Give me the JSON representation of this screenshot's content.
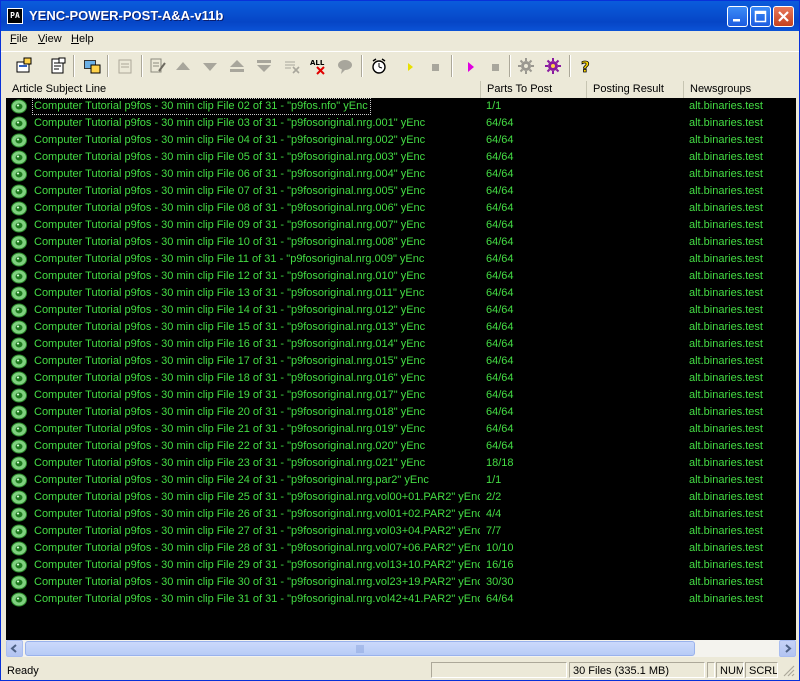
{
  "window": {
    "title": "YENC-POWER-POST-A&A-v11b",
    "app_icon_text": "PA"
  },
  "menu": [
    {
      "label": "File",
      "u": "F",
      "rest": "ile"
    },
    {
      "label": "View",
      "u": "V",
      "rest": "iew"
    },
    {
      "label": "Help",
      "u": "H",
      "rest": "elp"
    }
  ],
  "toolbar": {
    "buttons": [
      "properties-icon",
      "add-files-icon",
      "post-icon",
      "disabled-doc-icon",
      "edit-icon",
      "move-up-icon",
      "move-down-icon",
      "move-top-icon",
      "move-bottom-icon",
      "delete-icon",
      "delete-all-icon",
      "disabled-comment-icon",
      "timer-icon",
      "start-icon",
      "stop-icon",
      "start-magenta-icon",
      "stop-magenta-icon",
      "settings-gear-icon",
      "purple-gear-icon",
      "help-icon"
    ],
    "delete_all_label": "ALL"
  },
  "columns": {
    "subject": "Article Subject Line",
    "parts": "Parts To Post",
    "result": "Posting Result",
    "newsgroups": "Newsgroups"
  },
  "rows": [
    {
      "subject": "Computer Tutorial p9fos - 30 min clip File 02 of 31 - \"p9fos.nfo\" yEnc",
      "parts": "1/1",
      "result": "",
      "newsgroups": "alt.binaries.test"
    },
    {
      "subject": "Computer Tutorial p9fos - 30 min clip File 03 of 31 - \"p9fosoriginal.nrg.001\" yEnc",
      "parts": "64/64",
      "result": "",
      "newsgroups": "alt.binaries.test"
    },
    {
      "subject": "Computer Tutorial p9fos - 30 min clip File 04 of 31 - \"p9fosoriginal.nrg.002\" yEnc",
      "parts": "64/64",
      "result": "",
      "newsgroups": "alt.binaries.test"
    },
    {
      "subject": "Computer Tutorial p9fos - 30 min clip File 05 of 31 - \"p9fosoriginal.nrg.003\" yEnc",
      "parts": "64/64",
      "result": "",
      "newsgroups": "alt.binaries.test"
    },
    {
      "subject": "Computer Tutorial p9fos - 30 min clip File 06 of 31 - \"p9fosoriginal.nrg.004\" yEnc",
      "parts": "64/64",
      "result": "",
      "newsgroups": "alt.binaries.test"
    },
    {
      "subject": "Computer Tutorial p9fos - 30 min clip File 07 of 31 - \"p9fosoriginal.nrg.005\" yEnc",
      "parts": "64/64",
      "result": "",
      "newsgroups": "alt.binaries.test"
    },
    {
      "subject": "Computer Tutorial p9fos - 30 min clip File 08 of 31 - \"p9fosoriginal.nrg.006\" yEnc",
      "parts": "64/64",
      "result": "",
      "newsgroups": "alt.binaries.test"
    },
    {
      "subject": "Computer Tutorial p9fos - 30 min clip File 09 of 31 - \"p9fosoriginal.nrg.007\" yEnc",
      "parts": "64/64",
      "result": "",
      "newsgroups": "alt.binaries.test"
    },
    {
      "subject": "Computer Tutorial p9fos - 30 min clip File 10 of 31 - \"p9fosoriginal.nrg.008\" yEnc",
      "parts": "64/64",
      "result": "",
      "newsgroups": "alt.binaries.test"
    },
    {
      "subject": "Computer Tutorial p9fos - 30 min clip File 11 of 31 - \"p9fosoriginal.nrg.009\" yEnc",
      "parts": "64/64",
      "result": "",
      "newsgroups": "alt.binaries.test"
    },
    {
      "subject": "Computer Tutorial p9fos - 30 min clip File 12 of 31 - \"p9fosoriginal.nrg.010\" yEnc",
      "parts": "64/64",
      "result": "",
      "newsgroups": "alt.binaries.test"
    },
    {
      "subject": "Computer Tutorial p9fos - 30 min clip File 13 of 31 - \"p9fosoriginal.nrg.011\" yEnc",
      "parts": "64/64",
      "result": "",
      "newsgroups": "alt.binaries.test"
    },
    {
      "subject": "Computer Tutorial p9fos - 30 min clip File 14 of 31 - \"p9fosoriginal.nrg.012\" yEnc",
      "parts": "64/64",
      "result": "",
      "newsgroups": "alt.binaries.test"
    },
    {
      "subject": "Computer Tutorial p9fos - 30 min clip File 15 of 31 - \"p9fosoriginal.nrg.013\" yEnc",
      "parts": "64/64",
      "result": "",
      "newsgroups": "alt.binaries.test"
    },
    {
      "subject": "Computer Tutorial p9fos - 30 min clip File 16 of 31 - \"p9fosoriginal.nrg.014\" yEnc",
      "parts": "64/64",
      "result": "",
      "newsgroups": "alt.binaries.test"
    },
    {
      "subject": "Computer Tutorial p9fos - 30 min clip File 17 of 31 - \"p9fosoriginal.nrg.015\" yEnc",
      "parts": "64/64",
      "result": "",
      "newsgroups": "alt.binaries.test"
    },
    {
      "subject": "Computer Tutorial p9fos - 30 min clip File 18 of 31 - \"p9fosoriginal.nrg.016\" yEnc",
      "parts": "64/64",
      "result": "",
      "newsgroups": "alt.binaries.test"
    },
    {
      "subject": "Computer Tutorial p9fos - 30 min clip File 19 of 31 - \"p9fosoriginal.nrg.017\" yEnc",
      "parts": "64/64",
      "result": "",
      "newsgroups": "alt.binaries.test"
    },
    {
      "subject": "Computer Tutorial p9fos - 30 min clip File 20 of 31 - \"p9fosoriginal.nrg.018\" yEnc",
      "parts": "64/64",
      "result": "",
      "newsgroups": "alt.binaries.test"
    },
    {
      "subject": "Computer Tutorial p9fos - 30 min clip File 21 of 31 - \"p9fosoriginal.nrg.019\" yEnc",
      "parts": "64/64",
      "result": "",
      "newsgroups": "alt.binaries.test"
    },
    {
      "subject": "Computer Tutorial p9fos - 30 min clip File 22 of 31 - \"p9fosoriginal.nrg.020\" yEnc",
      "parts": "64/64",
      "result": "",
      "newsgroups": "alt.binaries.test"
    },
    {
      "subject": "Computer Tutorial p9fos - 30 min clip File 23 of 31 - \"p9fosoriginal.nrg.021\" yEnc",
      "parts": "18/18",
      "result": "",
      "newsgroups": "alt.binaries.test"
    },
    {
      "subject": "Computer Tutorial p9fos - 30 min clip File 24 of 31 - \"p9fosoriginal.nrg.par2\" yEnc",
      "parts": "1/1",
      "result": "",
      "newsgroups": "alt.binaries.test"
    },
    {
      "subject": "Computer Tutorial p9fos - 30 min clip File 25 of 31 - \"p9fosoriginal.nrg.vol00+01.PAR2\" yEnc",
      "parts": "2/2",
      "result": "",
      "newsgroups": "alt.binaries.test"
    },
    {
      "subject": "Computer Tutorial p9fos - 30 min clip File 26 of 31 - \"p9fosoriginal.nrg.vol01+02.PAR2\" yEnc",
      "parts": "4/4",
      "result": "",
      "newsgroups": "alt.binaries.test"
    },
    {
      "subject": "Computer Tutorial p9fos - 30 min clip File 27 of 31 - \"p9fosoriginal.nrg.vol03+04.PAR2\" yEnc",
      "parts": "7/7",
      "result": "",
      "newsgroups": "alt.binaries.test"
    },
    {
      "subject": "Computer Tutorial p9fos - 30 min clip File 28 of 31 - \"p9fosoriginal.nrg.vol07+06.PAR2\" yEnc",
      "parts": "10/10",
      "result": "",
      "newsgroups": "alt.binaries.test"
    },
    {
      "subject": "Computer Tutorial p9fos - 30 min clip File 29 of 31 - \"p9fosoriginal.nrg.vol13+10.PAR2\" yEnc",
      "parts": "16/16",
      "result": "",
      "newsgroups": "alt.binaries.test"
    },
    {
      "subject": "Computer Tutorial p9fos - 30 min clip File 30 of 31 - \"p9fosoriginal.nrg.vol23+19.PAR2\" yEnc",
      "parts": "30/30",
      "result": "",
      "newsgroups": "alt.binaries.test"
    },
    {
      "subject": "Computer Tutorial p9fos - 30 min clip File 31 of 31 - \"p9fosoriginal.nrg.vol42+41.PAR2\" yEnc",
      "parts": "64/64",
      "result": "",
      "newsgroups": "alt.binaries.test"
    }
  ],
  "status": {
    "left": "Ready",
    "files": "30 Files (335.1 MB)",
    "num": "NUM",
    "scrl": "SCRL"
  },
  "colors": {
    "list_bg": "#000000",
    "list_text": "#44dd44",
    "title_blue": "#0a5cdc"
  }
}
